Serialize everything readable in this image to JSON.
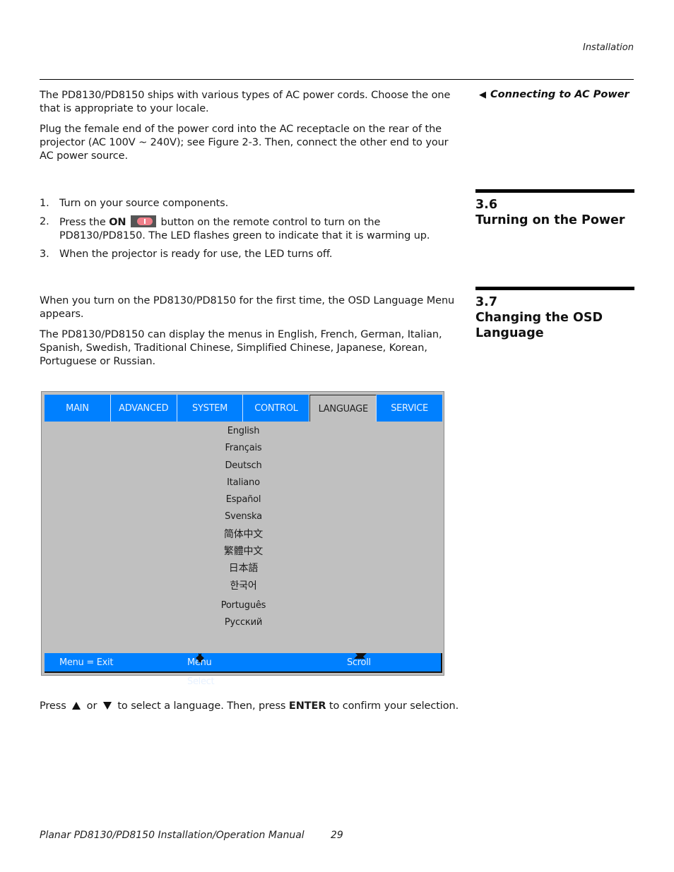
{
  "header": {
    "section_label": "Installation"
  },
  "ac_power": {
    "side_note": "Connecting to AC Power",
    "paragraphs": [
      "The PD8130/PD8150 ships with various types of AC power cords. Choose the one that is appropriate to your locale.",
      "Plug the female end of the power cord into the AC receptacle on the rear of the projector (AC 100V ~ 240V); see Figure 2-3. Then, connect the other end to your AC power source."
    ]
  },
  "section_3_6": {
    "number": "3.6",
    "title": "Turning on the Power",
    "steps": [
      {
        "num": "1.",
        "text": "Turn on your source components."
      },
      {
        "num": "2.",
        "pre": "Press the ",
        "bold": "ON",
        "post": " button on the remote control to turn on the PD8130/PD8150. The LED flashes green to indicate that it is warming up."
      },
      {
        "num": "3.",
        "text": "When the projector is ready for use, the LED turns off."
      }
    ]
  },
  "section_3_7": {
    "number": "3.7",
    "title_line1": "Changing the OSD",
    "title_line2": "Language",
    "paragraphs": [
      "When you turn on the PD8130/PD8150 for the first time, the OSD Language Menu appears.",
      "The PD8130/PD8150 can display the menus in English, French, German, Italian, Spanish, Swedish, Traditional Chinese, Simplified Chinese, Japanese, Korean, Portuguese or Russian."
    ],
    "instruction": {
      "pre": "Press ",
      "mid": " or ",
      "post1": " to select a language. Then, press ",
      "bold": "ENTER",
      "post2": " to confirm your selection."
    }
  },
  "osd_menu": {
    "tabs": [
      "MAIN",
      "ADVANCED",
      "SYSTEM",
      "CONTROL",
      "LANGUAGE",
      "SERVICE"
    ],
    "active_tab": "LANGUAGE",
    "languages": [
      "English",
      "Français",
      "Deutsch",
      "Italiano",
      "Español",
      "Svenska",
      "简体中文",
      "繁體中文",
      "日本語",
      "한국어",
      "Português",
      "Русский"
    ],
    "footer": {
      "exit": "Menu = Exit",
      "select": "Menu Select",
      "scroll": "Scroll"
    },
    "colors": {
      "tab_blue": "#0080ff",
      "panel_gray": "#c0c0c0"
    }
  },
  "footer": {
    "manual_title": "Planar PD8130/PD8150 Installation/Operation Manual",
    "page_number": "29"
  }
}
